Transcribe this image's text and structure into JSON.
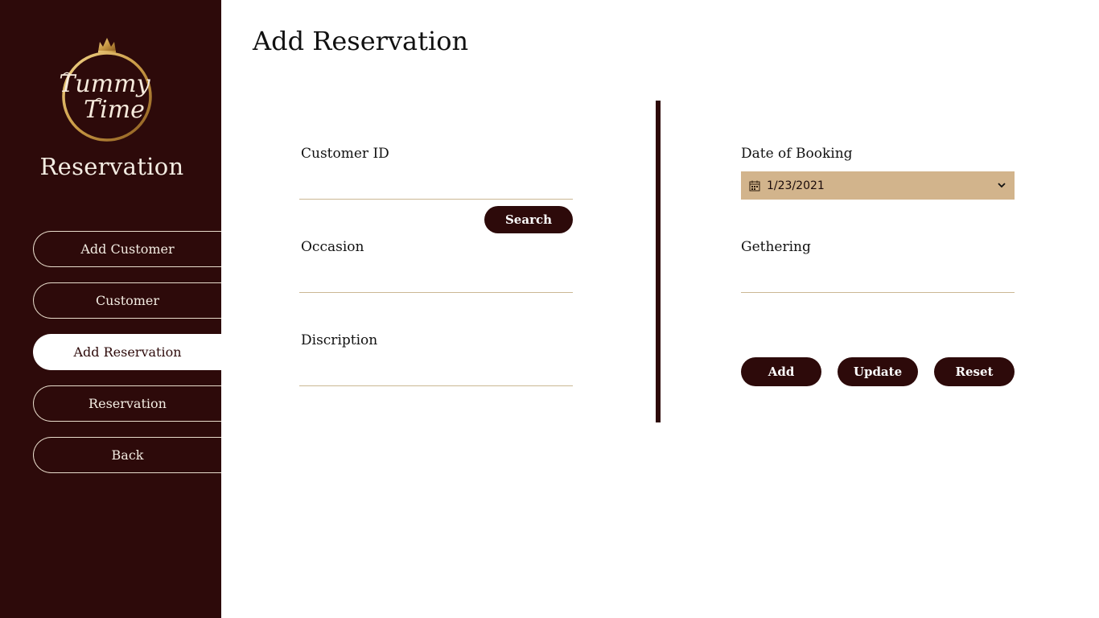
{
  "sidebar": {
    "logo_text": [
      "Tummy",
      "Time"
    ],
    "title": "Reservation",
    "items": [
      {
        "label": "Add Customer"
      },
      {
        "label": "Customer"
      },
      {
        "label": "Add Reservation",
        "active": true
      },
      {
        "label": "Reservation"
      },
      {
        "label": "Back"
      }
    ]
  },
  "main": {
    "title": "Add Reservation",
    "customer_id": {
      "label": "Customer ID",
      "value": ""
    },
    "search_button": "Search",
    "occasion": {
      "label": "Occasion",
      "value": ""
    },
    "description": {
      "label": "Discription",
      "value": ""
    },
    "date_of_booking": {
      "label": "Date of Booking",
      "value": "1/23/2021",
      "icon": "calendar-icon"
    },
    "gathering": {
      "label": "Gethering",
      "value": ""
    },
    "buttons": {
      "add": "Add",
      "update": "Update",
      "reset": "Reset"
    }
  },
  "colors": {
    "sidebar_bg": "#2d0a0a",
    "accent_gold": "#d2b48c",
    "button_bg": "#2d0a0a",
    "underline": "#cbb894"
  }
}
